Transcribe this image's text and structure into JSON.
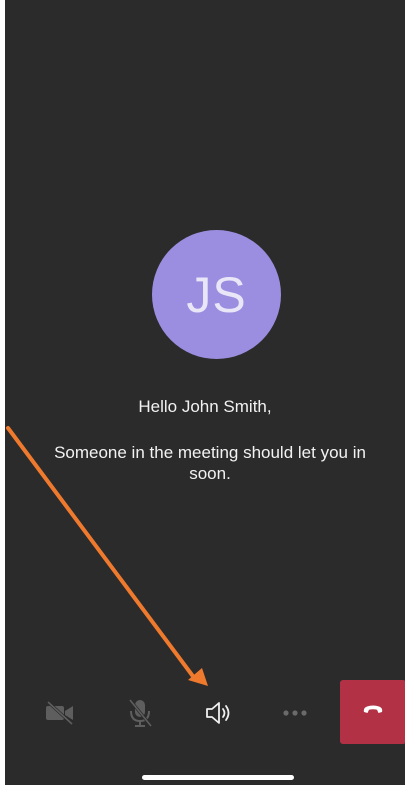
{
  "caller": {
    "initials": "JS",
    "avatar_color": "#9b8ee0"
  },
  "messages": {
    "greeting": "Hello John Smith,",
    "waiting": "Someone in the meeting should let you in soon."
  },
  "controls": [
    {
      "name": "camera-off",
      "icon": "video-off-icon",
      "state": "off"
    },
    {
      "name": "mic-off",
      "icon": "mic-off-icon",
      "state": "off"
    },
    {
      "name": "speaker",
      "icon": "speaker-icon",
      "state": "on"
    },
    {
      "name": "more-options",
      "icon": "more-dots-icon"
    },
    {
      "name": "hang-up",
      "icon": "phone-hangup-icon",
      "color": "#b23145"
    }
  ],
  "annotation": {
    "type": "arrow",
    "color": "#ef7a2e",
    "points_to": "speaker-button"
  }
}
